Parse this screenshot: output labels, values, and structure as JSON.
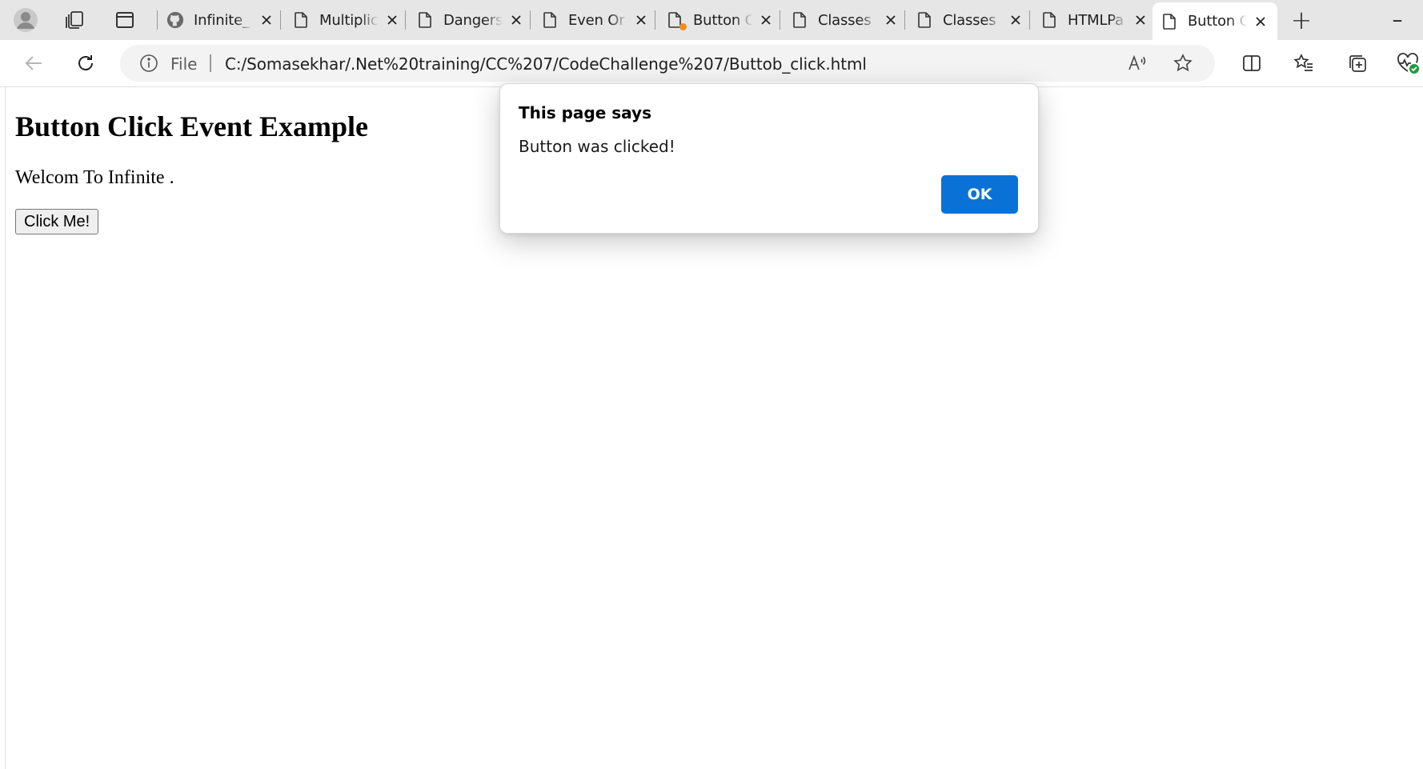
{
  "tabstrip": {
    "tabs": [
      {
        "title": "Infinite_",
        "favicon": "github-icon"
      },
      {
        "title": "Multiplic",
        "favicon": "page-icon"
      },
      {
        "title": "Dangers",
        "favicon": "page-icon"
      },
      {
        "title": "Even Or",
        "favicon": "page-icon"
      },
      {
        "title": "Button C",
        "favicon": "page-icon"
      },
      {
        "title": "Classes",
        "favicon": "page-icon"
      },
      {
        "title": "Classes",
        "favicon": "page-icon"
      },
      {
        "title": "HTMLPa",
        "favicon": "page-icon"
      },
      {
        "title": "Button C",
        "favicon": "page-icon"
      }
    ],
    "active_tab_index": 8,
    "new_tab_symbol": "+",
    "minimize_symbol": "–"
  },
  "toolbar": {
    "scheme_label": "File",
    "url": "C:/Somasekhar/.Net%20training/CC%207/CodeChallenge%207/Buttob_click.html"
  },
  "page": {
    "heading": "Button Click Event Example",
    "paragraph": "Welcom To Infinite .",
    "button_label": "Click Me!"
  },
  "dialog": {
    "title": "This page says",
    "message": "Button was clicked!",
    "ok_label": "OK"
  },
  "colors": {
    "accent": "#0a72d6",
    "tabstrip_bg": "#e6e6e6",
    "unsaved_dot": "#f08b1d"
  }
}
